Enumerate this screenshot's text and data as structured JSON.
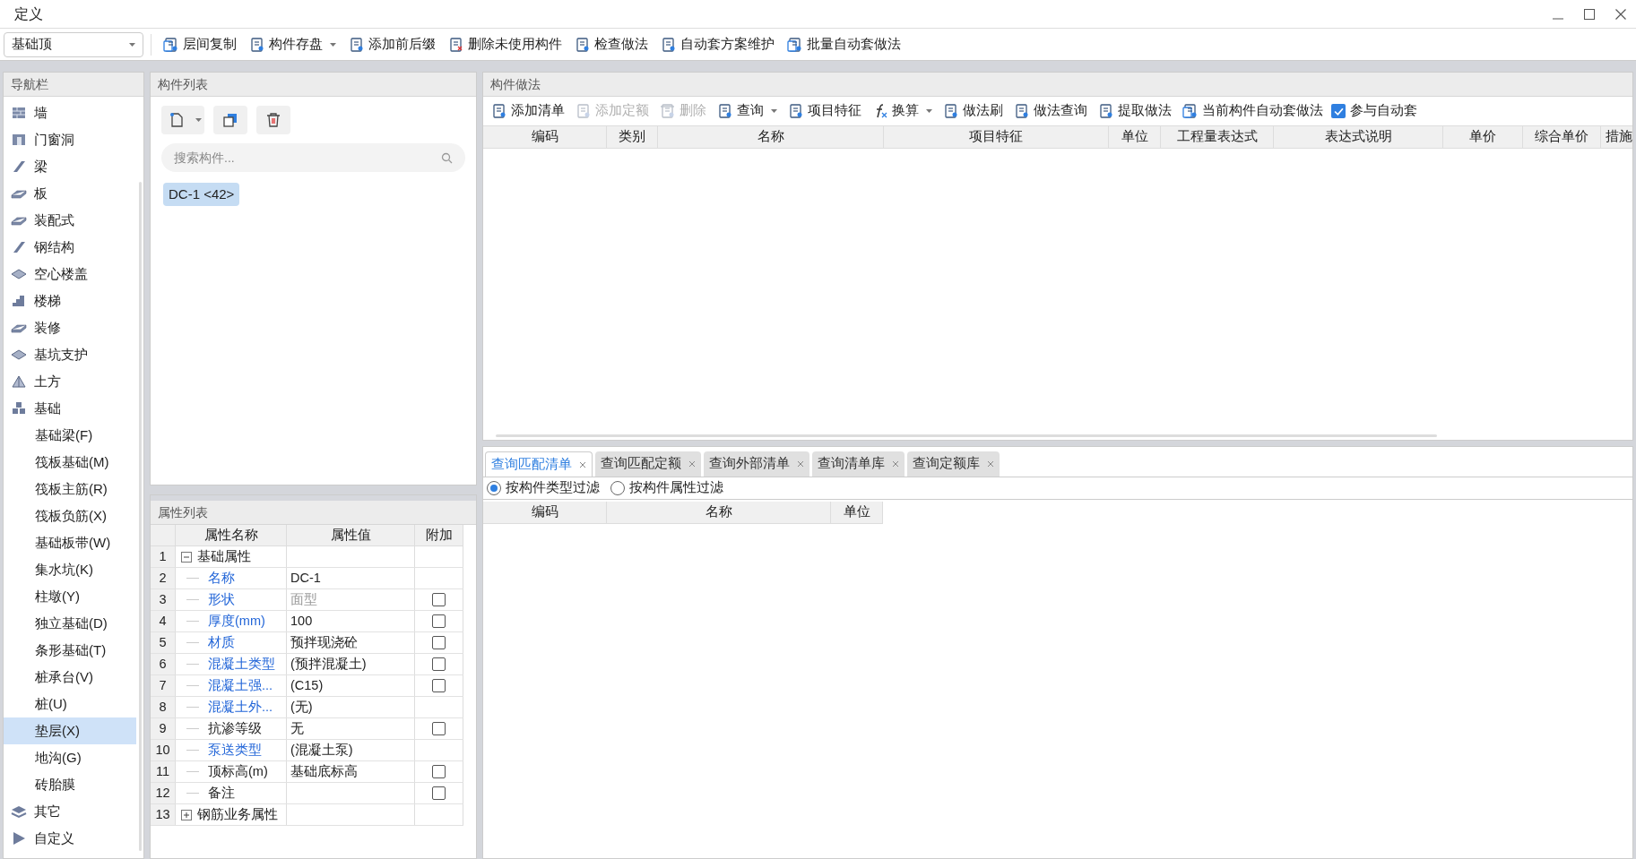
{
  "window": {
    "title": "定义"
  },
  "toolbar": {
    "floor": "基础顶",
    "buttons": [
      {
        "label": "层间复制",
        "dropdown": false
      },
      {
        "label": "构件存盘",
        "dropdown": true
      },
      {
        "label": "添加前后缀",
        "dropdown": false
      },
      {
        "label": "删除未使用构件",
        "dropdown": false
      },
      {
        "label": "检查做法",
        "dropdown": false
      },
      {
        "label": "自动套方案维护",
        "dropdown": false
      },
      {
        "label": "批量自动套做法",
        "dropdown": false
      }
    ]
  },
  "nav": {
    "title": "导航栏",
    "items": [
      {
        "label": "墙",
        "selected": false
      },
      {
        "label": "门窗洞",
        "selected": false
      },
      {
        "label": "梁",
        "selected": false
      },
      {
        "label": "板",
        "selected": false
      },
      {
        "label": "装配式",
        "selected": false
      },
      {
        "label": "钢结构",
        "selected": false
      },
      {
        "label": "空心楼盖",
        "selected": false
      },
      {
        "label": "楼梯",
        "selected": false
      },
      {
        "label": "装修",
        "selected": false
      },
      {
        "label": "基坑支护",
        "selected": false
      },
      {
        "label": "土方",
        "selected": false
      },
      {
        "label": "基础",
        "selected": false,
        "children": [
          {
            "label": "基础梁(F)",
            "selected": false
          },
          {
            "label": "筏板基础(M)",
            "selected": false
          },
          {
            "label": "筏板主筋(R)",
            "selected": false
          },
          {
            "label": "筏板负筋(X)",
            "selected": false
          },
          {
            "label": "基础板带(W)",
            "selected": false
          },
          {
            "label": "集水坑(K)",
            "selected": false
          },
          {
            "label": "柱墩(Y)",
            "selected": false
          },
          {
            "label": "独立基础(D)",
            "selected": false
          },
          {
            "label": "条形基础(T)",
            "selected": false
          },
          {
            "label": "桩承台(V)",
            "selected": false
          },
          {
            "label": "桩(U)",
            "selected": false
          },
          {
            "label": "垫层(X)",
            "selected": true
          },
          {
            "label": "地沟(G)",
            "selected": false
          },
          {
            "label": "砖胎膜",
            "selected": false
          }
        ]
      },
      {
        "label": "其它",
        "selected": false
      },
      {
        "label": "自定义",
        "selected": false
      }
    ]
  },
  "component_list": {
    "title": "构件列表",
    "search_placeholder": "搜索构件...",
    "items": [
      {
        "label": "DC-1 <42>",
        "selected": true
      }
    ]
  },
  "properties": {
    "title": "属性列表",
    "columns": [
      "属性名称",
      "属性值",
      "附加"
    ],
    "rows": [
      {
        "index": "1",
        "kind": "group",
        "name": "基础属性",
        "expanded": true
      },
      {
        "index": "2",
        "kind": "prop",
        "name": "名称",
        "value": "DC-1",
        "link": true
      },
      {
        "index": "3",
        "kind": "prop",
        "name": "形状",
        "value": "面型",
        "link": true,
        "disabled": true,
        "checked": false
      },
      {
        "index": "4",
        "kind": "prop",
        "name": "厚度(mm)",
        "value": "100",
        "link": true,
        "checked": false
      },
      {
        "index": "5",
        "kind": "prop",
        "name": "材质",
        "value": "预拌现浇砼",
        "link": true,
        "checked": false
      },
      {
        "index": "6",
        "kind": "prop",
        "name": "混凝土类型",
        "value": "(预拌混凝土)",
        "link": true,
        "checked": false
      },
      {
        "index": "7",
        "kind": "prop",
        "name": "混凝土强...",
        "value": "(C15)",
        "link": true,
        "checked": false
      },
      {
        "index": "8",
        "kind": "prop",
        "name": "混凝土外...",
        "value": "(无)",
        "link": true
      },
      {
        "index": "9",
        "kind": "prop",
        "name": "抗渗等级",
        "value": "无",
        "link": false,
        "checked": false
      },
      {
        "index": "10",
        "kind": "prop",
        "name": "泵送类型",
        "value": "(混凝土泵)",
        "link": true
      },
      {
        "index": "11",
        "kind": "prop",
        "name": "顶标高(m)",
        "value": "基础底标高",
        "link": false,
        "checked": false
      },
      {
        "index": "12",
        "kind": "prop",
        "name": "备注",
        "link": false,
        "checked": false
      },
      {
        "index": "13",
        "kind": "group",
        "name": "钢筋业务属性",
        "expanded": false
      }
    ]
  },
  "method": {
    "title": "构件做法",
    "toolbar": [
      {
        "label": "添加清单",
        "disabled": false,
        "dropdown": false
      },
      {
        "label": "添加定额",
        "disabled": true,
        "dropdown": false
      },
      {
        "label": "删除",
        "disabled": true,
        "dropdown": false
      },
      {
        "label": "查询",
        "disabled": false,
        "dropdown": true
      },
      {
        "label": "项目特征",
        "disabled": false,
        "dropdown": false
      },
      {
        "label": "换算",
        "disabled": false,
        "dropdown": true
      },
      {
        "label": "做法刷",
        "disabled": false,
        "dropdown": false
      },
      {
        "label": "做法查询",
        "disabled": false,
        "dropdown": false
      },
      {
        "label": "提取做法",
        "disabled": false,
        "dropdown": false
      },
      {
        "label": "当前构件自动套做法",
        "disabled": false,
        "dropdown": false
      }
    ],
    "auto_checkbox": {
      "label": "参与自动套",
      "checked": true
    },
    "columns": [
      "编码",
      "类别",
      "名称",
      "项目特征",
      "单位",
      "工程量表达式",
      "表达式说明",
      "单价",
      "综合单价",
      "措施"
    ]
  },
  "query": {
    "tabs": [
      {
        "label": "查询匹配清单",
        "selected": true
      },
      {
        "label": "查询匹配定额",
        "selected": false
      },
      {
        "label": "查询外部清单",
        "selected": false
      },
      {
        "label": "查询清单库",
        "selected": false
      },
      {
        "label": "查询定额库",
        "selected": false
      }
    ],
    "filters": [
      {
        "label": "按构件类型过滤",
        "selected": true
      },
      {
        "label": "按构件属性过滤",
        "selected": false
      }
    ],
    "columns": [
      "编码",
      "名称",
      "单位"
    ]
  }
}
